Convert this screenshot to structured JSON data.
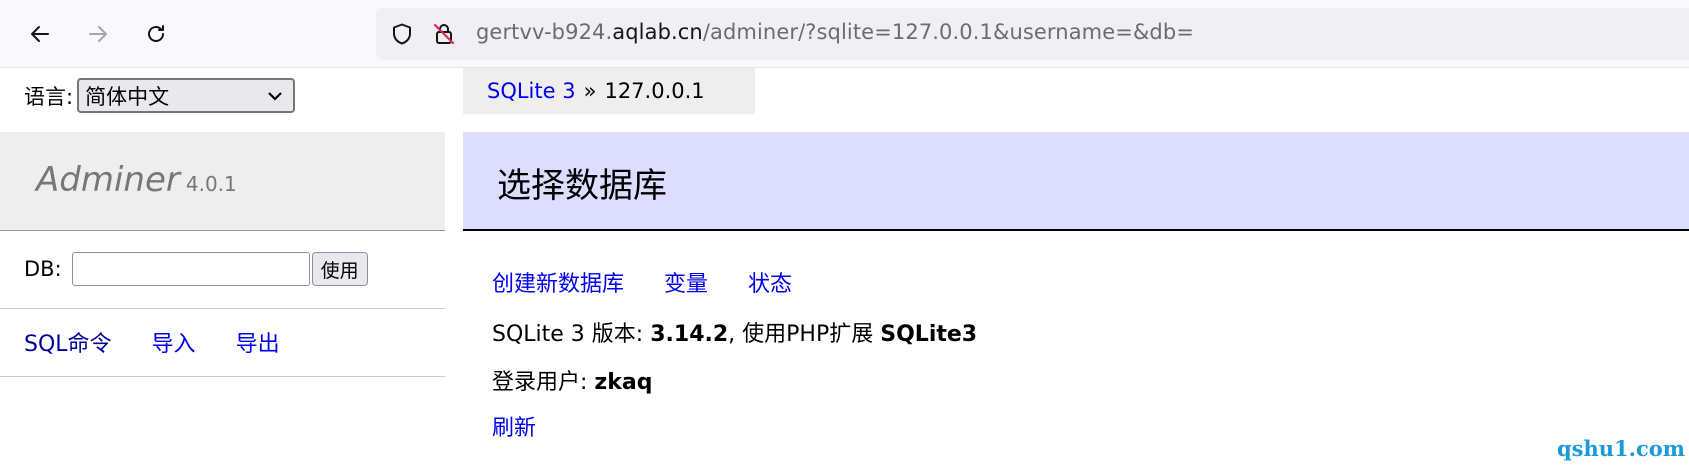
{
  "browser": {
    "url_prefix": "gertvv-b924.",
    "url_host": "aqlab.cn",
    "url_path": "/adminer/?sqlite=127.0.0.1&username=&db="
  },
  "language": {
    "label": "语言:",
    "selected": "简体中文"
  },
  "brand": {
    "name": "Adminer",
    "version": "4.0.1"
  },
  "db_form": {
    "label": "DB:",
    "value": "",
    "button": "使用"
  },
  "sidebar_links": [
    "SQL命令",
    "导入",
    "导出"
  ],
  "breadcrumb": {
    "driver": "SQLite 3",
    "separator": "»",
    "server": "127.0.0.1"
  },
  "heading": "选择数据库",
  "main_links": [
    "创建新数据库",
    "变量",
    "状态"
  ],
  "version_info": {
    "prefix": "SQLite 3 版本:",
    "version": "3.14.2",
    "middle": ", 使用PHP扩展",
    "extension": "SQLite3"
  },
  "user_info": {
    "prefix": "登录用户:",
    "user": "zkaq"
  },
  "refresh": "刷新",
  "watermark": "qshu1.com",
  "colors": {
    "link": "#0000ee",
    "heading_bg": "#ddddff",
    "watermark": "#1a9bd7"
  }
}
